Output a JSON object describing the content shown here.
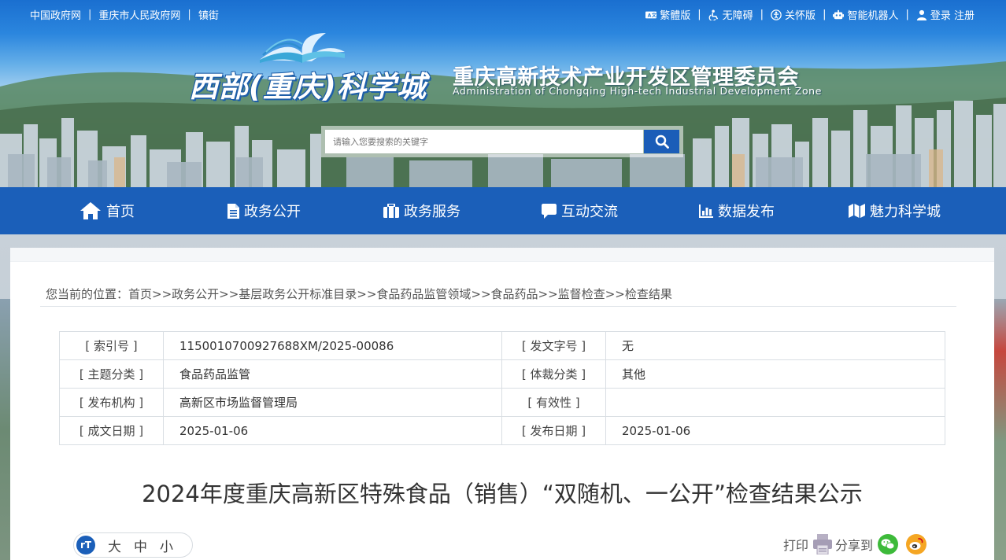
{
  "topbar": {
    "left_links": [
      "中国政府网",
      "重庆市人民政府网",
      "镇街"
    ],
    "right_links": [
      {
        "icon": "language-icon",
        "label": "繁體版"
      },
      {
        "icon": "accessibility-icon",
        "label": "无障碍"
      },
      {
        "icon": "elder-care-icon",
        "label": "关怀版"
      },
      {
        "icon": "robot-icon",
        "label": "智能机器人"
      },
      {
        "icon": "user-icon",
        "label": "登录 注册"
      }
    ]
  },
  "header": {
    "logo_text": "西部(重庆)科学城",
    "org_title": "重庆高新技术产业开发区管理委员会",
    "org_subtitle": "Administration of Chongqing High-tech Industrial Development Zone"
  },
  "search": {
    "placeholder": "请输入您要搜索的关键字",
    "button_icon": "search-icon"
  },
  "nav": {
    "items": [
      {
        "label": "首页",
        "icon": "home-icon"
      },
      {
        "label": "政务公开",
        "icon": "document-icon"
      },
      {
        "label": "政务服务",
        "icon": "briefcase-icon"
      },
      {
        "label": "互动交流",
        "icon": "chat-icon"
      },
      {
        "label": "数据发布",
        "icon": "bar-chart-icon"
      },
      {
        "label": "魅力科学城",
        "icon": "map-icon"
      }
    ]
  },
  "breadcrumb": "您当前的位置：首页>>政务公开>>基层政务公开标准目录>>食品药品监管领域>>食品药品>>监督检查>>检查结果",
  "meta": {
    "rows": [
      {
        "k1": "[ 索引号 ]",
        "v1": "1150010700927688XM/2025-00086",
        "k2": "[ 发文字号 ]",
        "v2": "无"
      },
      {
        "k1": "[ 主题分类 ]",
        "v1": "食品药品监管",
        "k2": "[ 体裁分类 ]",
        "v2": "其他"
      },
      {
        "k1": "[ 发布机构 ]",
        "v1": "高新区市场监督管理局",
        "k2": "[ 有效性 ]",
        "v2": ""
      },
      {
        "k1": "[ 成文日期 ]",
        "v1": "2025-01-06",
        "k2": "[ 发布日期 ]",
        "v2": "2025-01-06"
      }
    ]
  },
  "article": {
    "title": "2024年度重庆高新区特殊食品（销售）“双随机、一公开”检查结果公示"
  },
  "fontsize": {
    "icon_text": "rT",
    "options": [
      "大",
      "中",
      "小"
    ]
  },
  "share": {
    "print_label": "打印",
    "share_label": "分享到"
  },
  "colors": {
    "nav_bg": "#1b5fb9",
    "accent": "#1b5db8"
  }
}
